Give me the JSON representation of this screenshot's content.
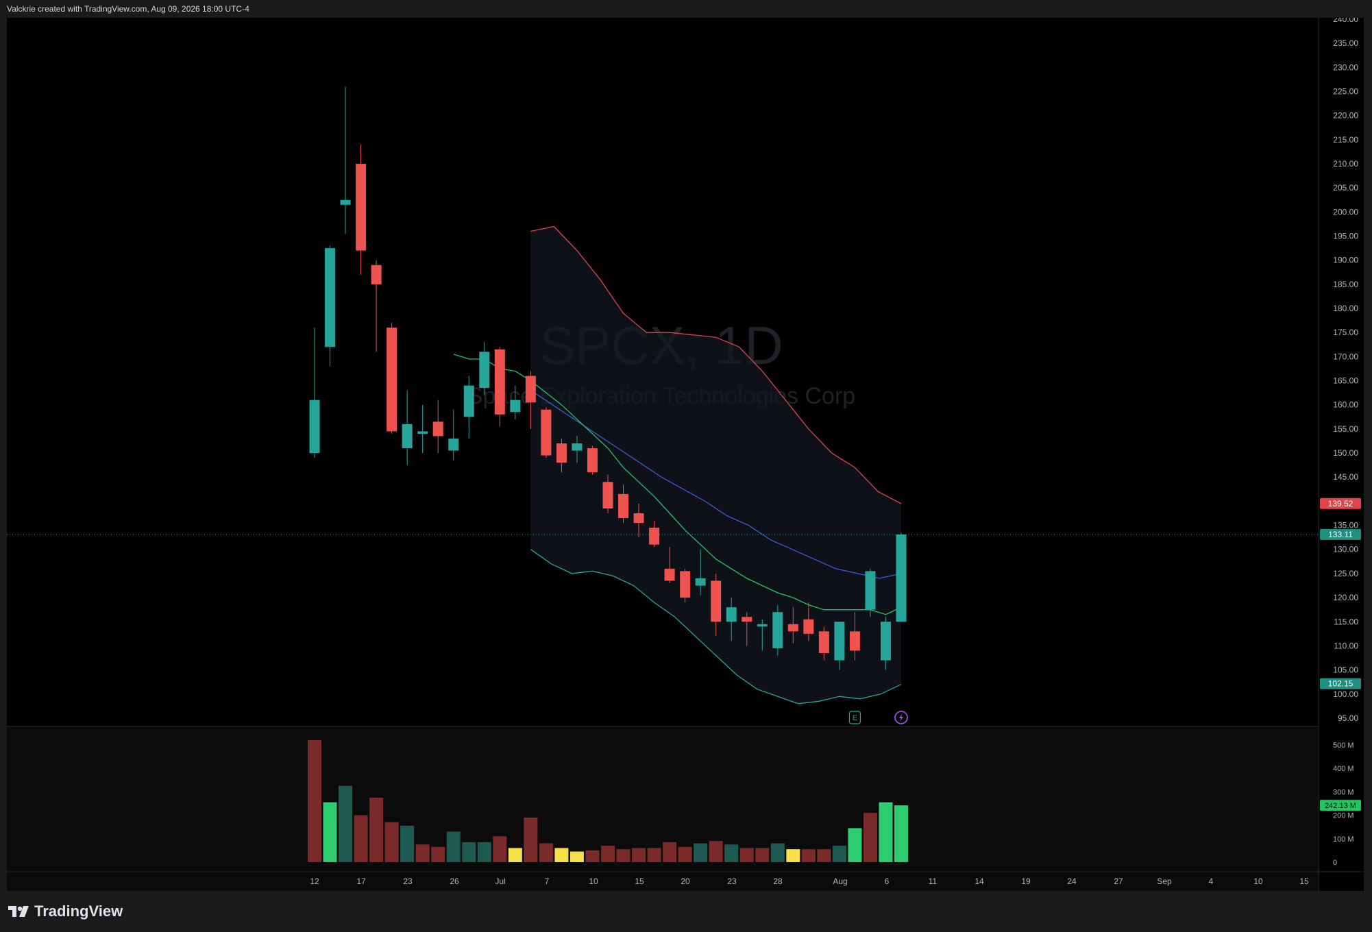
{
  "header": {
    "text": "Valckrie created with TradingView.com, Aug 09, 2026 18:00 UTC-4"
  },
  "watermark": {
    "symbol": "SPCX, 1D",
    "name": "Space Exploration Technologies Corp"
  },
  "branding": {
    "name": "TradingView"
  },
  "colors": {
    "up": "#26a69a",
    "down": "#ef5350",
    "upper_band": "#e0434a",
    "middle_line": "#3b5bdb",
    "lower_band": "#26a69a",
    "ema": "#22c55e",
    "vol_up": "#1f5a52",
    "vol_down": "#7b2a2a",
    "vol_high": "#2ecc71",
    "vol_low": "#f5e04a"
  },
  "markers": {
    "earnings_label": "E"
  },
  "chart_data": {
    "type": "candlestick",
    "y_axis": {
      "ticks": [
        "240.00",
        "235.00",
        "230.00",
        "225.00",
        "220.00",
        "215.00",
        "210.00",
        "205.00",
        "200.00",
        "195.00",
        "190.00",
        "185.00",
        "180.00",
        "175.00",
        "170.00",
        "165.00",
        "160.00",
        "155.00",
        "150.00",
        "145.00",
        "140.00",
        "135.00",
        "130.00",
        "125.00",
        "120.00",
        "115.00",
        "110.00",
        "105.00",
        "100.00",
        "95.00"
      ],
      "range": [
        93,
        240
      ]
    },
    "x_axis": {
      "labels": [
        "12",
        "17",
        "23",
        "26",
        "Jul",
        "7",
        "10",
        "15",
        "20",
        "23",
        "28",
        "Aug",
        "6",
        "11",
        "14",
        "19",
        "24",
        "27",
        "Sep",
        "4",
        "10",
        "15"
      ]
    },
    "price_labels": {
      "upper": "139.52",
      "last": "133.11",
      "lower": "102.15"
    },
    "candles": [
      {
        "o": 150,
        "h": 176,
        "l": 149,
        "c": 161,
        "dir": "up"
      },
      {
        "o": 172,
        "h": 193,
        "l": 168,
        "c": 192.5,
        "dir": "up"
      },
      {
        "o": 201.5,
        "h": 226,
        "l": 195.5,
        "c": 202.5,
        "dir": "up"
      },
      {
        "o": 210,
        "h": 214,
        "l": 187,
        "c": 192,
        "dir": "down"
      },
      {
        "o": 189,
        "h": 190,
        "l": 171,
        "c": 185,
        "dir": "down"
      },
      {
        "o": 176,
        "h": 177,
        "l": 154,
        "c": 154.5,
        "dir": "down"
      },
      {
        "o": 151,
        "h": 163,
        "l": 147.5,
        "c": 156,
        "dir": "up"
      },
      {
        "o": 154,
        "h": 160,
        "l": 150,
        "c": 154.5,
        "dir": "up"
      },
      {
        "o": 156.5,
        "h": 161,
        "l": 150,
        "c": 153.5,
        "dir": "down"
      },
      {
        "o": 150.5,
        "h": 159,
        "l": 148.5,
        "c": 153,
        "dir": "up"
      },
      {
        "o": 157.5,
        "h": 166,
        "l": 153,
        "c": 164,
        "dir": "up"
      },
      {
        "o": 163.5,
        "h": 173,
        "l": 162,
        "c": 171,
        "dir": "up"
      },
      {
        "o": 171.5,
        "h": 172,
        "l": 155.5,
        "c": 158,
        "dir": "down"
      },
      {
        "o": 158.5,
        "h": 164,
        "l": 157,
        "c": 161,
        "dir": "up"
      },
      {
        "o": 166,
        "h": 167,
        "l": 155,
        "c": 160.5,
        "dir": "down"
      },
      {
        "o": 159,
        "h": 159.5,
        "l": 149,
        "c": 149.5,
        "dir": "down"
      },
      {
        "o": 152,
        "h": 153,
        "l": 146,
        "c": 148,
        "dir": "down"
      },
      {
        "o": 150.5,
        "h": 153.5,
        "l": 148,
        "c": 152,
        "dir": "up"
      },
      {
        "o": 151,
        "h": 151.5,
        "l": 145.5,
        "c": 146,
        "dir": "down"
      },
      {
        "o": 144,
        "h": 145.5,
        "l": 137.5,
        "c": 138.5,
        "dir": "down"
      },
      {
        "o": 141.5,
        "h": 143.5,
        "l": 135.5,
        "c": 136.5,
        "dir": "down"
      },
      {
        "o": 137.5,
        "h": 139.5,
        "l": 132.5,
        "c": 135.5,
        "dir": "down"
      },
      {
        "o": 134.5,
        "h": 136,
        "l": 130.5,
        "c": 131,
        "dir": "down"
      },
      {
        "o": 126,
        "h": 130.5,
        "l": 123,
        "c": 123.5,
        "dir": "down"
      },
      {
        "o": 125.5,
        "h": 126,
        "l": 119,
        "c": 120,
        "dir": "down"
      },
      {
        "o": 122.5,
        "h": 130,
        "l": 120.5,
        "c": 124,
        "dir": "up"
      },
      {
        "o": 123.5,
        "h": 125,
        "l": 112,
        "c": 115,
        "dir": "down"
      },
      {
        "o": 115,
        "h": 120,
        "l": 111,
        "c": 118,
        "dir": "up"
      },
      {
        "o": 116,
        "h": 117,
        "l": 110,
        "c": 115,
        "dir": "down"
      },
      {
        "o": 114,
        "h": 115.5,
        "l": 109,
        "c": 114.5,
        "dir": "up"
      },
      {
        "o": 109.5,
        "h": 118.5,
        "l": 108,
        "c": 117,
        "dir": "up"
      },
      {
        "o": 114.5,
        "h": 118,
        "l": 110.5,
        "c": 113,
        "dir": "down"
      },
      {
        "o": 115.5,
        "h": 119,
        "l": 111,
        "c": 112.5,
        "dir": "down"
      },
      {
        "o": 113,
        "h": 114,
        "l": 107,
        "c": 108.5,
        "dir": "down"
      },
      {
        "o": 107,
        "h": 115,
        "l": 105,
        "c": 115,
        "dir": "up"
      },
      {
        "o": 113,
        "h": 117,
        "l": 107,
        "c": 109,
        "dir": "down"
      },
      {
        "o": 117.5,
        "h": 126,
        "l": 116,
        "c": 125.5,
        "dir": "up"
      },
      {
        "o": 107,
        "h": 116,
        "l": 105,
        "c": 115,
        "dir": "up"
      },
      {
        "o": 115,
        "h": 133.5,
        "l": 115,
        "c": 133.11,
        "dir": "up"
      }
    ],
    "indicators": {
      "upper_band": [
        196,
        197,
        192,
        186,
        179,
        175,
        175,
        174.5,
        174,
        172,
        167,
        161,
        155,
        150,
        147,
        142,
        139.5
      ],
      "middle_line": [
        163,
        160,
        157,
        154,
        151,
        148,
        145,
        142.5,
        140,
        137,
        135,
        132,
        130,
        128,
        126,
        125,
        124,
        125
      ],
      "lower_band": [
        130,
        127,
        125,
        125.5,
        124.5,
        122.5,
        119,
        116,
        112,
        108,
        104,
        101,
        99.5,
        98,
        98.5,
        99.5,
        99,
        100,
        102
      ],
      "ema": [
        170.5,
        169.5,
        169.5,
        167.5,
        167,
        165,
        162.5,
        160,
        157,
        154,
        151,
        147,
        144,
        141,
        137.5,
        134,
        131,
        128,
        126,
        124,
        122.5,
        121,
        120,
        118.5,
        117.5,
        117.5,
        117.5,
        117.5,
        116.5,
        118
      ]
    },
    "volume": {
      "axis_labels": [
        "500 M",
        "400 M",
        "300 M",
        "200 M",
        "100 M",
        "0"
      ],
      "last_label": "242.13 M",
      "bars": [
        {
          "v": 520,
          "kind": "down"
        },
        {
          "v": 255,
          "kind": "high"
        },
        {
          "v": 325,
          "kind": "up"
        },
        {
          "v": 200,
          "kind": "down"
        },
        {
          "v": 275,
          "kind": "down"
        },
        {
          "v": 170,
          "kind": "down"
        },
        {
          "v": 155,
          "kind": "up"
        },
        {
          "v": 75,
          "kind": "down"
        },
        {
          "v": 65,
          "kind": "down"
        },
        {
          "v": 130,
          "kind": "up"
        },
        {
          "v": 85,
          "kind": "up"
        },
        {
          "v": 85,
          "kind": "up"
        },
        {
          "v": 110,
          "kind": "down"
        },
        {
          "v": 60,
          "kind": "low"
        },
        {
          "v": 190,
          "kind": "down"
        },
        {
          "v": 80,
          "kind": "down"
        },
        {
          "v": 60,
          "kind": "low"
        },
        {
          "v": 45,
          "kind": "low"
        },
        {
          "v": 50,
          "kind": "down"
        },
        {
          "v": 70,
          "kind": "down"
        },
        {
          "v": 55,
          "kind": "down"
        },
        {
          "v": 60,
          "kind": "down"
        },
        {
          "v": 60,
          "kind": "down"
        },
        {
          "v": 85,
          "kind": "down"
        },
        {
          "v": 65,
          "kind": "down"
        },
        {
          "v": 80,
          "kind": "up"
        },
        {
          "v": 90,
          "kind": "down"
        },
        {
          "v": 75,
          "kind": "up"
        },
        {
          "v": 60,
          "kind": "down"
        },
        {
          "v": 60,
          "kind": "down"
        },
        {
          "v": 80,
          "kind": "up"
        },
        {
          "v": 55,
          "kind": "low"
        },
        {
          "v": 55,
          "kind": "down"
        },
        {
          "v": 55,
          "kind": "down"
        },
        {
          "v": 70,
          "kind": "up"
        },
        {
          "v": 145,
          "kind": "high"
        },
        {
          "v": 210,
          "kind": "down"
        },
        {
          "v": 255,
          "kind": "high"
        },
        {
          "v": 242,
          "kind": "high"
        }
      ]
    }
  }
}
